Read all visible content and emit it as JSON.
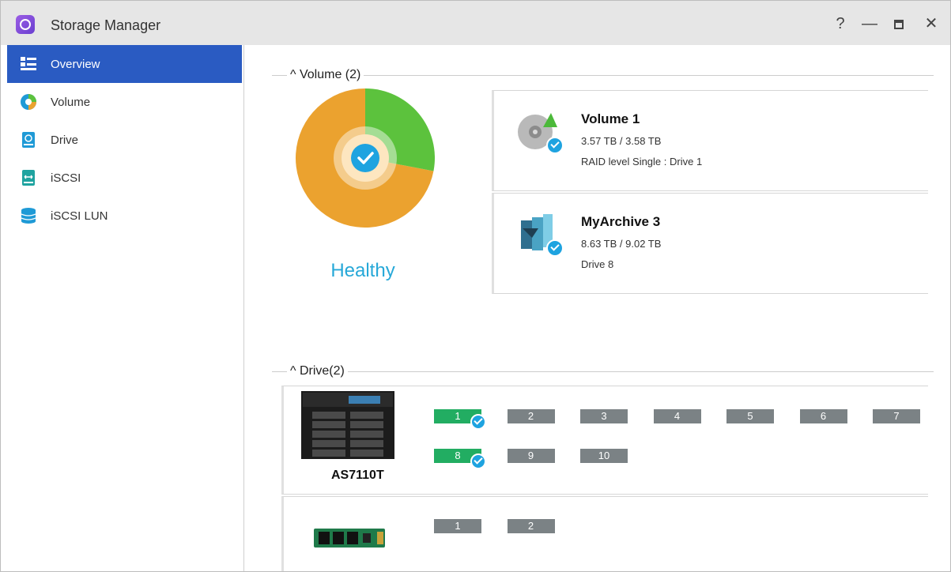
{
  "window": {
    "title": "Storage Manager",
    "help_glyph": "?",
    "minimize_glyph": "—",
    "close_glyph": "✕",
    "app_icon": "storage-manager-icon"
  },
  "sidebar": {
    "items": [
      {
        "label": "Overview",
        "icon": "overview-icon",
        "active": true
      },
      {
        "label": "Volume",
        "icon": "volume-pie-icon"
      },
      {
        "label": "Drive",
        "icon": "drive-icon"
      },
      {
        "label": "iSCSI",
        "icon": "iscsi-icon"
      },
      {
        "label": "iSCSI LUN",
        "icon": "iscsi-lun-icon"
      }
    ]
  },
  "volume_section": {
    "caret": "^",
    "title": "Volume (2)",
    "status": "Healthy",
    "usage_chart": {
      "used_fraction": 0.72,
      "free_fraction": 0.28,
      "used_color": "#eba22f",
      "free_color": "#5cc23d",
      "center_icon": "check-icon"
    },
    "volumes": [
      {
        "name": "Volume 1",
        "size": "3.57 TB / 3.58 TB",
        "desc": "RAID level Single : Drive 1",
        "icon": "volume-disk-icon"
      },
      {
        "name": "MyArchive 3",
        "size": "8.63 TB / 9.02 TB",
        "desc": "Drive 8",
        "icon": "myarchive-icon"
      }
    ]
  },
  "drive_section": {
    "caret": "^",
    "title": "Drive(2)",
    "nas": {
      "model": "AS7110T",
      "slots": [
        {
          "label": "1",
          "ok": true
        },
        {
          "label": "2"
        },
        {
          "label": "3"
        },
        {
          "label": "4"
        },
        {
          "label": "5"
        },
        {
          "label": "6"
        },
        {
          "label": "7"
        },
        {
          "label": "8",
          "ok": true
        },
        {
          "label": "9"
        },
        {
          "label": "10"
        }
      ]
    },
    "m2": {
      "slots": [
        {
          "label": "1"
        },
        {
          "label": "2"
        }
      ]
    }
  },
  "colors": {
    "accent": "#2a5bc2",
    "healthy": "#26a8d8",
    "ok_slot": "#22ad62",
    "empty_slot": "#7b8285"
  }
}
